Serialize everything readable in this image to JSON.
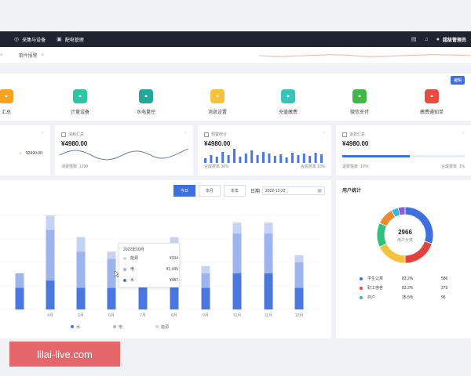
{
  "topbar": {
    "nav": [
      {
        "icon": "target-icon",
        "glyph": "◎",
        "label": "采集与设备"
      },
      {
        "icon": "inbox-icon",
        "glyph": "▣",
        "label": "配电管理"
      }
    ],
    "user": "超级管理员"
  },
  "tabs": [
    {
      "label": "事件报警"
    }
  ],
  "shortcuts": {
    "edit_label": "编辑",
    "items": [
      {
        "label": "汇总",
        "color": "#f4a21f",
        "icon": "summary-icon"
      },
      {
        "label": "计量设备",
        "color": "#2bc6a6",
        "icon": "meter-icon"
      },
      {
        "label": "水电量控",
        "color": "#26a69a",
        "icon": "utility-icon"
      },
      {
        "label": "消息设置",
        "color": "#f6c23e",
        "icon": "message-icon"
      },
      {
        "label": "充值缴费",
        "color": "#36c5b8",
        "icon": "card-icon"
      },
      {
        "label": "微信支付",
        "color": "#43b649",
        "icon": "wechat-icon"
      },
      {
        "label": "缴费通知单",
        "color": "#e74c3c",
        "icon": "bill-icon"
      }
    ]
  },
  "stats": {
    "card0": {
      "value": "¥2490.00"
    },
    "card1": {
      "title": "消耗汇总",
      "value": "¥4980.00",
      "foot": "消费笔数",
      "foot_value": "1290"
    },
    "card2": {
      "title": "预警统计",
      "value": "¥4980.00",
      "foot_l": "合成费率",
      "foot_l_value": "90%",
      "foot_r": "合成费率",
      "foot_r_value": "10%"
    },
    "card3": {
      "title": "退费汇总",
      "value": "¥4980.00",
      "foot_l": "退费笔数",
      "foot_l_value": "10%",
      "foot_r": "合成费率",
      "foot_r_value": "1%",
      "progress": 0.55
    }
  },
  "filters": {
    "today": "今日",
    "month": "本月",
    "half": "本年",
    "date_label": "日期",
    "date_value": "2022-12-22"
  },
  "chart_data": {
    "type": "bar",
    "stacked": true,
    "categories": [
      "",
      "4月",
      "5月",
      "6月",
      "7月",
      "8月",
      "9月",
      "10月",
      "11月",
      "12月"
    ],
    "series": [
      {
        "name": "水",
        "color": "#4a78e0",
        "values": [
          30,
          40,
          30,
          30,
          40,
          40,
          30,
          50,
          50,
          30
        ]
      },
      {
        "name": "电",
        "color": "#9db4ee",
        "values": [
          20,
          70,
          50,
          40,
          30,
          40,
          20,
          55,
          55,
          35
        ]
      },
      {
        "name": "能源",
        "color": "#c6d3f5",
        "values": [
          0,
          20,
          20,
          10,
          10,
          20,
          10,
          15,
          15,
          10
        ]
      }
    ]
  },
  "tooltip": {
    "title": "2022年10月",
    "rows": [
      {
        "name": "能源",
        "value": "¥334",
        "color": "#d0d6e0"
      },
      {
        "name": "电",
        "value": "¥1,445",
        "color": "#9db4ee"
      },
      {
        "name": "水",
        "value": "¥487",
        "color": "#4a78e0"
      }
    ]
  },
  "user_stats": {
    "title": "用户统计",
    "total": "2966",
    "total_label": "用户分类",
    "legend": [
      {
        "name": "学生公寓",
        "pct": "83.2%",
        "num": "586",
        "color": "#3d6fe0"
      },
      {
        "name": "职工宿舍",
        "pct": "83.2%",
        "num": "275",
        "color": "#e74c3c"
      },
      {
        "name": "商户",
        "pct": "35.5%",
        "num": "96",
        "color": "#2ec27e"
      }
    ],
    "donut": [
      {
        "value": 30,
        "color": "#3d6fe0"
      },
      {
        "value": 20,
        "color": "#e0423d"
      },
      {
        "value": 18,
        "color": "#f6c23e"
      },
      {
        "value": 14,
        "color": "#2ec27e"
      },
      {
        "value": 10,
        "color": "#f08a2e"
      },
      {
        "value": 4,
        "color": "#36b8e6"
      },
      {
        "value": 4,
        "color": "#8a5de0"
      }
    ]
  },
  "watermark": "lilai-live.com"
}
